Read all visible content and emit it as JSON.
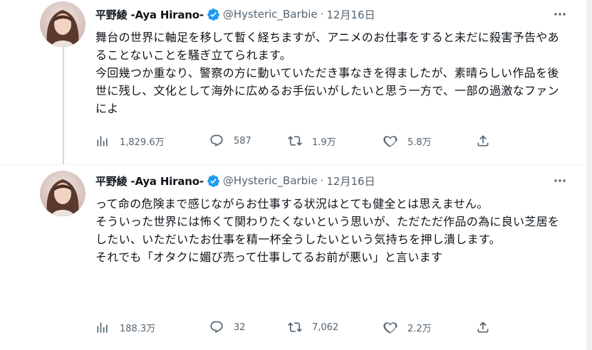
{
  "colors": {
    "text": "#0f1419",
    "secondary": "#536471",
    "verified_badge": "#1d9bf0",
    "thread_line": "#cfd9de",
    "divider": "#eff3f4"
  },
  "tweets": [
    {
      "author": {
        "name": "平野綾 -Aya Hirano-",
        "handle": "@Hysteric_Barbie",
        "separator": "·",
        "date": "12月16日"
      },
      "text": "舞台の世界に軸足を移して暫く経ちますが、アニメのお仕事をすると未だに殺害予告やあることないことを騒ぎ立てられます。\n今回幾つか重なり、警察の方に動いていただき事なきを得ましたが、素晴らしい作品を後世に残し、文化として海外に広めるお手伝いがしたいと思う一方で、一部の過激なファンによ",
      "stats": {
        "views": "1,829.6万",
        "replies": "587",
        "retweets": "1.9万",
        "likes": "5.8万"
      }
    },
    {
      "author": {
        "name": "平野綾 -Aya Hirano-",
        "handle": "@Hysteric_Barbie",
        "separator": "·",
        "date": "12月16日"
      },
      "text": "って命の危険まで感じながらお仕事する状況はとても健全とは思えません。\nそういった世界には怖くて関わりたくないという思いが、ただただ作品の為に良い芝居をしたい、いただいたお仕事を精一杯全うしたいという気持ちを押し潰します。\nそれでも「オタクに媚び売って仕事してるお前が悪い」と言います",
      "stats": {
        "views": "188.3万",
        "replies": "32",
        "retweets": "7,062",
        "likes": "2.2万"
      }
    }
  ],
  "icons": {
    "avatar": "avatar-photo",
    "verified": "verified-badge-icon",
    "more": "more-icon",
    "views": "views-icon",
    "reply": "reply-icon",
    "retweet": "retweet-icon",
    "like": "like-icon",
    "share": "share-icon"
  }
}
